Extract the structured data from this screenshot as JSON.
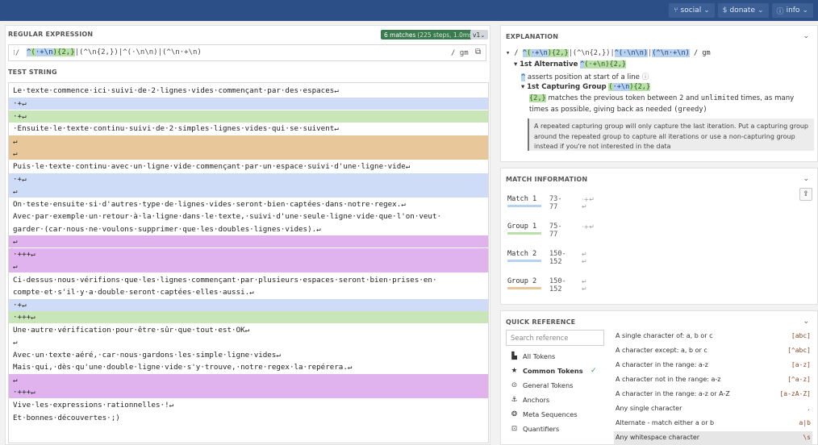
{
  "topbar": {
    "buttons": [
      {
        "icon": "branch-icon",
        "glyph": "⑂",
        "label": "social"
      },
      {
        "icon": "dollar-icon",
        "glyph": "$",
        "label": "donate"
      },
      {
        "icon": "info-icon",
        "glyph": "ⓘ",
        "label": "info"
      }
    ]
  },
  "regex": {
    "section_title": "REGULAR EXPRESSION",
    "matches_badge": "6 matches",
    "matches_sub": "(225 steps, 1.0ms)",
    "flavor": "v1",
    "delimiter": "/",
    "pattern_tokens": [
      {
        "t": "^",
        "c": "tk-blue"
      },
      {
        "t": "(",
        "c": "tk-green"
      },
      {
        "t": "·+\\n",
        "c": "tk-blue"
      },
      {
        "t": "){2,}",
        "c": "tk-green"
      },
      {
        "t": "|",
        "c": "tk-alt"
      },
      {
        "t": "(^\\n{2,})",
        "c": "tk-gray"
      },
      {
        "t": "|",
        "c": "tk-alt"
      },
      {
        "t": "^(·\\n\\n)",
        "c": "tk-gray"
      },
      {
        "t": "|",
        "c": "tk-alt"
      },
      {
        "t": "(^\\n·+\\n)",
        "c": "tk-gray"
      }
    ],
    "flags": "/ gm"
  },
  "test_string": {
    "section_title": "TEST STRING",
    "lines": [
      {
        "text": "Le·texte·commence·ici·suivi·de·2·lignes·vides·commençant·par·des·espaces↵",
        "hl": ""
      },
      {
        "text": "·+↵",
        "hl": "hl-blue"
      },
      {
        "text": "·+↵",
        "hl": "hl-green"
      },
      {
        "text": "·Ensuite·le·texte·continu·suivi·de·2·simples·lignes·vides·qui·se·suivent↵",
        "hl": ""
      },
      {
        "text": "↵",
        "hl": "hl-orange"
      },
      {
        "text": "↵",
        "hl": "hl-orange"
      },
      {
        "text": "Puis·le·texte·continu·avec·un·ligne·vide·commençant·par·un·espace·suivi·d'une·ligne·vide↵",
        "hl": ""
      },
      {
        "text": "·+↵",
        "hl": "hl-blue"
      },
      {
        "text": "↵",
        "hl": "hl-blue"
      },
      {
        "text": "On·teste·ensuite·si·d'autres·type·de·lignes·vides·seront·bien·captées·dans·notre·regex.↵",
        "hl": ""
      },
      {
        "text": "Avec·par·exemple·un·retour·à·la·ligne·dans·le·texte,·suivi·d'une·seule·ligne·vide·que·l'on·veut·",
        "hl": ""
      },
      {
        "text": "garder·(car·nous·ne·voulons·supprimer·que·les·doubles·lignes·vides).↵",
        "hl": ""
      },
      {
        "text": "↵",
        "hl": "hl-purple"
      },
      {
        "text": "·+++↵",
        "hl": "hl-purple"
      },
      {
        "text": "↵",
        "hl": "hl-purple"
      },
      {
        "text": "Ci-dessus·nous·vérifions·que·les·lignes·commençant·par·plusieurs·espaces·seront·bien·prises·en·",
        "hl": ""
      },
      {
        "text": "compte·et·s'il·y·a·double·seront·captées·elles·aussi.↵",
        "hl": ""
      },
      {
        "text": "·+↵",
        "hl": "hl-blue"
      },
      {
        "text": "·+++↵",
        "hl": "hl-green"
      },
      {
        "text": "Une·autre·vérification·pour·être·sûr·que·tout·est·OK↵",
        "hl": ""
      },
      {
        "text": "↵",
        "hl": ""
      },
      {
        "text": "Avec·un·texte·aéré,·car·nous·gardons·les·simple·ligne·vides↵",
        "hl": ""
      },
      {
        "text": "Mais·qui,·dès·qu'une·double·ligne·vide·s'y·trouve,·notre·regex·la·repérera.↵",
        "hl": ""
      },
      {
        "text": "↵",
        "hl": "hl-purple"
      },
      {
        "text": "·+++↵",
        "hl": "hl-purple"
      },
      {
        "text": "Vive·les·expressions·rationnelles·!↵",
        "hl": ""
      },
      {
        "text": "Et·bonnes·découvertes·;)",
        "hl": ""
      }
    ]
  },
  "explanation": {
    "title": "EXPLANATION",
    "root_flags": "/ gm",
    "root_pattern_tokens": [
      {
        "t": "^",
        "c": "tk-blue"
      },
      {
        "t": "(",
        "c": "tk-green"
      },
      {
        "t": "·+\\n",
        "c": "tk-blue"
      },
      {
        "t": "){2,}",
        "c": "tk-green"
      },
      {
        "t": "|",
        "c": "tk-alt"
      },
      {
        "t": "(^\\n{2,})",
        "c": "tk-gray"
      },
      {
        "t": "|",
        "c": "tk-alt"
      },
      {
        "t": "^(·\\n\\n)",
        "c": "tk-blue"
      },
      {
        "t": "|",
        "c": "tk-alt"
      },
      {
        "t": "(^\\n·+\\n)",
        "c": "tk-blue"
      }
    ],
    "alt_label": "1st Alternative",
    "alt_pattern_a": "^",
    "alt_pattern_b": "(·+\\n){2,}",
    "caret_token": "^",
    "caret_desc": "asserts position at start of a line",
    "group_label": "1st Capturing Group",
    "group_pattern_a": "(",
    "group_pattern_b": "·+\\n",
    "group_pattern_c": "){2,}",
    "quant_token": "{2,}",
    "quant_desc_1": "matches the previous token between",
    "quant_desc_2": "2",
    "quant_desc_3": "and",
    "quant_desc_4": "unlimited",
    "quant_desc_5": "times, as many",
    "quant_desc_6": "times as possible, giving back as needed",
    "quant_desc_7": "(greedy)",
    "note": "A repeated capturing group will only capture the last iteration. Put a capturing group around the repeated group to capture all iterations or use a non-capturing group instead if you're not interested in the data"
  },
  "match_info": {
    "title": "MATCH INFORMATION",
    "rows": [
      {
        "label": "Match 1",
        "range": "73-77",
        "mark": "·+↵\n↵",
        "color": "#b7d2f0"
      },
      {
        "label": "Group 1",
        "range": "75-77",
        "mark": "·+↵",
        "color": "#b8e0a8"
      },
      {
        "label": "Match 2",
        "range": "150-152",
        "mark": "↵\n↵",
        "color": "#b7d2f0"
      },
      {
        "label": "Group 2",
        "range": "150-152",
        "mark": "↵\n↵",
        "color": "#e8c89a"
      }
    ]
  },
  "quick_ref": {
    "title": "QUICK REFERENCE",
    "search_placeholder": "Search reference",
    "categories": [
      {
        "icon": "folder-icon",
        "glyph": "▙",
        "label": "All Tokens"
      },
      {
        "icon": "star-icon",
        "glyph": "★",
        "label": "Common Tokens",
        "active": true
      },
      {
        "icon": "circle-dot-icon",
        "glyph": "⊙",
        "label": "General Tokens"
      },
      {
        "icon": "anchor-icon",
        "glyph": "⚓",
        "label": "Anchors"
      },
      {
        "icon": "meta-icon",
        "glyph": "❂",
        "label": "Meta Sequences"
      },
      {
        "icon": "quantifier-icon",
        "glyph": "⊡",
        "label": "Quantifiers"
      }
    ],
    "rows": [
      {
        "desc": "A single character of: a, b or c",
        "code": "[abc]"
      },
      {
        "desc": "A character except: a, b or c",
        "code": "[^abc]"
      },
      {
        "desc": "A character in the range: a-z",
        "code": "[a-z]"
      },
      {
        "desc": "A character not in the range: a-z",
        "code": "[^a-z]"
      },
      {
        "desc": "A character in the range: a-z or A-Z",
        "code": "[a-zA-Z]"
      },
      {
        "desc": "Any single character",
        "code": "."
      },
      {
        "desc": "Alternate - match either a or b",
        "code": "a|b"
      },
      {
        "desc": "Any whitespace character",
        "code": "\\s"
      }
    ]
  }
}
